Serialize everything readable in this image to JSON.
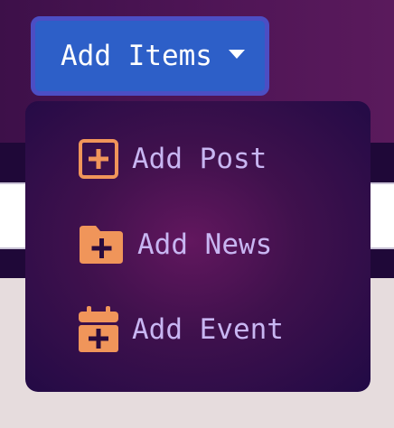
{
  "header": {
    "add_button_label": "Add Items"
  },
  "dropdown": {
    "items": [
      {
        "label": "Add Post",
        "icon": "square-plus-icon"
      },
      {
        "label": "Add News",
        "icon": "folder-plus-icon"
      },
      {
        "label": "Add Event",
        "icon": "calendar-plus-icon"
      }
    ]
  },
  "colors": {
    "button_bg": "#2d5fc8",
    "icon_orange": "#f0955a",
    "menu_text": "#c8b6f2"
  }
}
